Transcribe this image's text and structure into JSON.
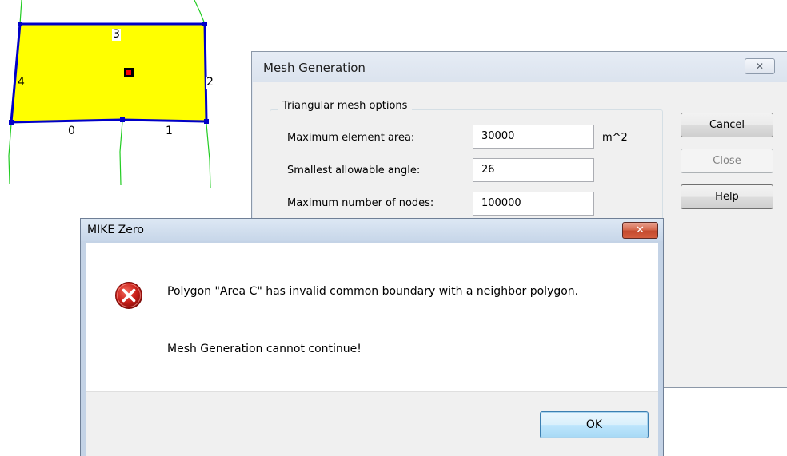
{
  "map": {
    "polygon_fill": "#ffff00",
    "boundary_color": "#0000c8",
    "neighbor_line_color": "#22cc22",
    "centroid_color": "#ff0000",
    "edge_labels": [
      "0",
      "1",
      "2",
      "3",
      "4"
    ]
  },
  "mesh_dialog": {
    "title": "Mesh Generation",
    "close_icon": "close-icon",
    "group_title": "Triangular mesh options",
    "fields": [
      {
        "label": "Maximum element area:",
        "value": "30000",
        "unit": "m^2"
      },
      {
        "label": "Smallest allowable angle:",
        "value": "26"
      },
      {
        "label": "Maximum number of nodes:",
        "value": "100000"
      }
    ],
    "buttons": {
      "cancel": "Cancel",
      "close": "Close",
      "help": "Help"
    }
  },
  "error_dialog": {
    "title": "MIKE Zero",
    "close_icon": "close-icon",
    "icon": "error-icon",
    "message_line1": "Polygon \"Area C\" has invalid common boundary with a neighbor polygon.",
    "message_line2": "Mesh Generation cannot continue!",
    "ok_label": "OK"
  }
}
